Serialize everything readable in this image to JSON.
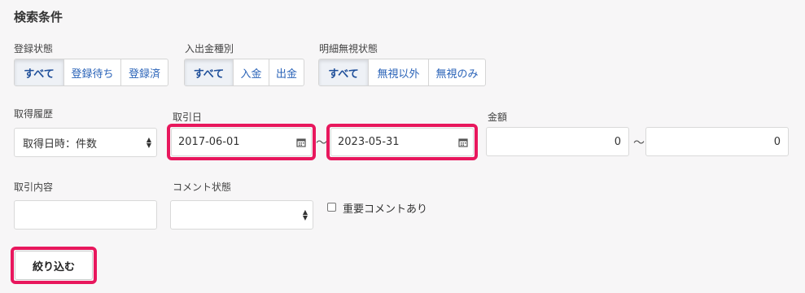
{
  "search": {
    "title": "検索条件"
  },
  "registration_status": {
    "label": "登録状態",
    "options": [
      "すべて",
      "登録待ち",
      "登録済"
    ],
    "selected": "すべて"
  },
  "deposit_type": {
    "label": "入出金種別",
    "options": [
      "すべて",
      "入金",
      "出金"
    ],
    "selected": "すべて"
  },
  "ignore_status": {
    "label": "明細無視状態",
    "options": [
      "すべて",
      "無視以外",
      "無視のみ"
    ],
    "selected": "すべて"
  },
  "acquisition_history": {
    "label": "取得履歴",
    "value": "取得日時：件数"
  },
  "transaction_date": {
    "label": "取引日",
    "from": "2017-06-01",
    "to": "2023-05-31",
    "separator": "〜"
  },
  "amount": {
    "label": "金額",
    "from": "0",
    "to": "0",
    "separator": "〜"
  },
  "transaction_content": {
    "label": "取引内容",
    "value": ""
  },
  "comment_status": {
    "label": "コメント状態",
    "value": ""
  },
  "important_comment": {
    "label": "重要コメントあり",
    "checked": false
  },
  "filter_button": {
    "label": "絞り込む"
  },
  "colors": {
    "highlight": "#e8175d",
    "link": "#2a63b8"
  }
}
